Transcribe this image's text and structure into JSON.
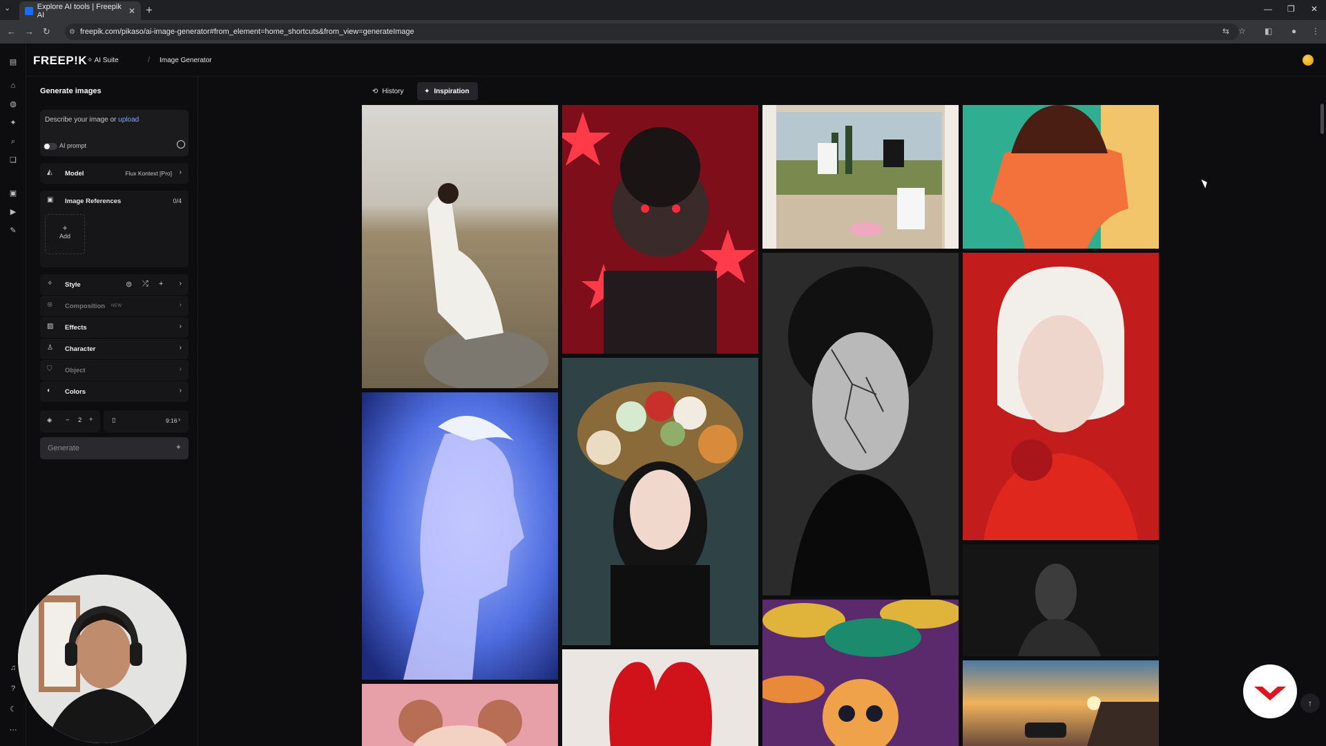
{
  "browser": {
    "tab_title": "Explore AI tools | Freepik AI",
    "tab_close": "✕",
    "new_tab": "+",
    "url": "freepik.com/pikaso/ai-image-generator#from_element=home_shortcuts&from_view=generateImage"
  },
  "header": {
    "logo": "FREEP!K",
    "suite": "AI Suite",
    "separator": "/",
    "page": "Image Generator"
  },
  "view_tabs": {
    "history": "History",
    "inspiration": "Inspiration"
  },
  "panel": {
    "title": "Generate images",
    "prompt_placeholder": "Describe your image or ",
    "prompt_upload": "upload",
    "ai_prompt_label": "AI prompt",
    "model_label": "Model",
    "model_value": "Flux Kontext [Pro]",
    "refs_label": "Image References",
    "refs_count": "0/4",
    "add_label": "Add",
    "style_label": "Style",
    "composition_label": "Composition",
    "composition_badge": "NEW",
    "effects_label": "Effects",
    "character_label": "Character",
    "object_label": "Object",
    "colors_label": "Colors",
    "count_minus": "−",
    "count_value": "2",
    "count_plus": "+",
    "ratio_value": "9:16",
    "generate_label": "Generate"
  },
  "icons": {
    "rail": [
      "sidebar-toggle-icon",
      "home-icon",
      "globe-icon",
      "sparkle-icon",
      "search-icon",
      "layers-icon",
      "image-icon",
      "video-icon",
      "edit-icon",
      "bell-icon",
      "help-icon",
      "moon-icon",
      "more-icon"
    ]
  },
  "colors": {
    "accent_link": "#7fa7ff",
    "background": "#0d0d0f",
    "brand_fab": "#e0141e"
  }
}
